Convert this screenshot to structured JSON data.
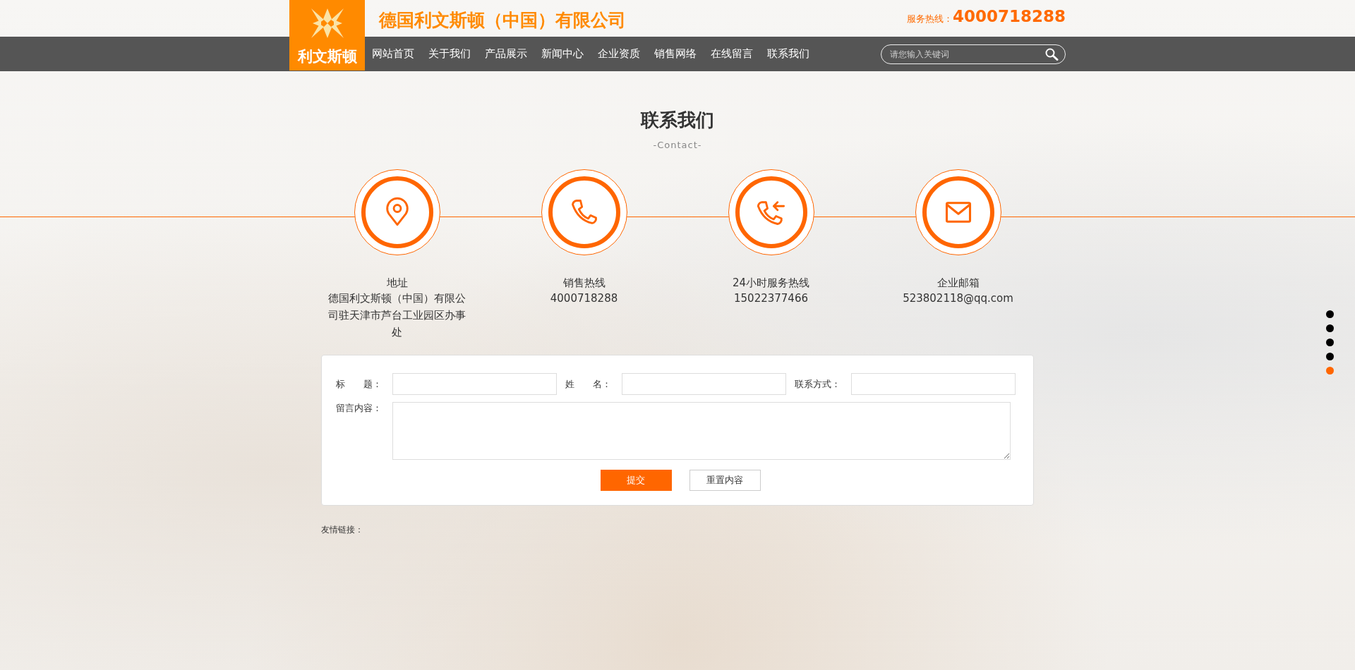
{
  "header": {
    "logo_text": "利文斯顿",
    "company_name": "德国利文斯顿（中国）有限公司",
    "hotline_label": "服务热线：",
    "hotline_number": "4000718288"
  },
  "nav": {
    "items": [
      {
        "label": "网站首页"
      },
      {
        "label": "关于我们"
      },
      {
        "label": "产品展示"
      },
      {
        "label": "新闻中心"
      },
      {
        "label": "企业资质"
      },
      {
        "label": "销售网络"
      },
      {
        "label": "在线留言"
      },
      {
        "label": "联系我们"
      }
    ],
    "search": {
      "placeholder": "请您输入关键词"
    }
  },
  "section": {
    "title": "联系我们",
    "subtitle": "-Contact-"
  },
  "contacts": [
    {
      "kind": "location",
      "label": "地址",
      "value": "德国利文斯顿（中国）有限公司驻天津市芦台工业园区办事处"
    },
    {
      "kind": "phone",
      "label": "销售热线",
      "value": "4000718288"
    },
    {
      "kind": "callback",
      "label": "24小时服务热线",
      "value": "15022377466"
    },
    {
      "kind": "mail",
      "label": "企业邮箱",
      "value": "523802118@qq.com"
    }
  ],
  "form": {
    "fields": [
      {
        "label": "标　　题："
      },
      {
        "label": "姓　　名："
      },
      {
        "label": "联系方式："
      }
    ],
    "message_label": "留言内容：",
    "submit": "提交",
    "reset": "重置内容"
  },
  "friend_links_label": "友情链接：",
  "page_dots": [
    {
      "selected": false
    },
    {
      "selected": false
    },
    {
      "selected": false
    },
    {
      "selected": false
    },
    {
      "selected": true
    }
  ]
}
